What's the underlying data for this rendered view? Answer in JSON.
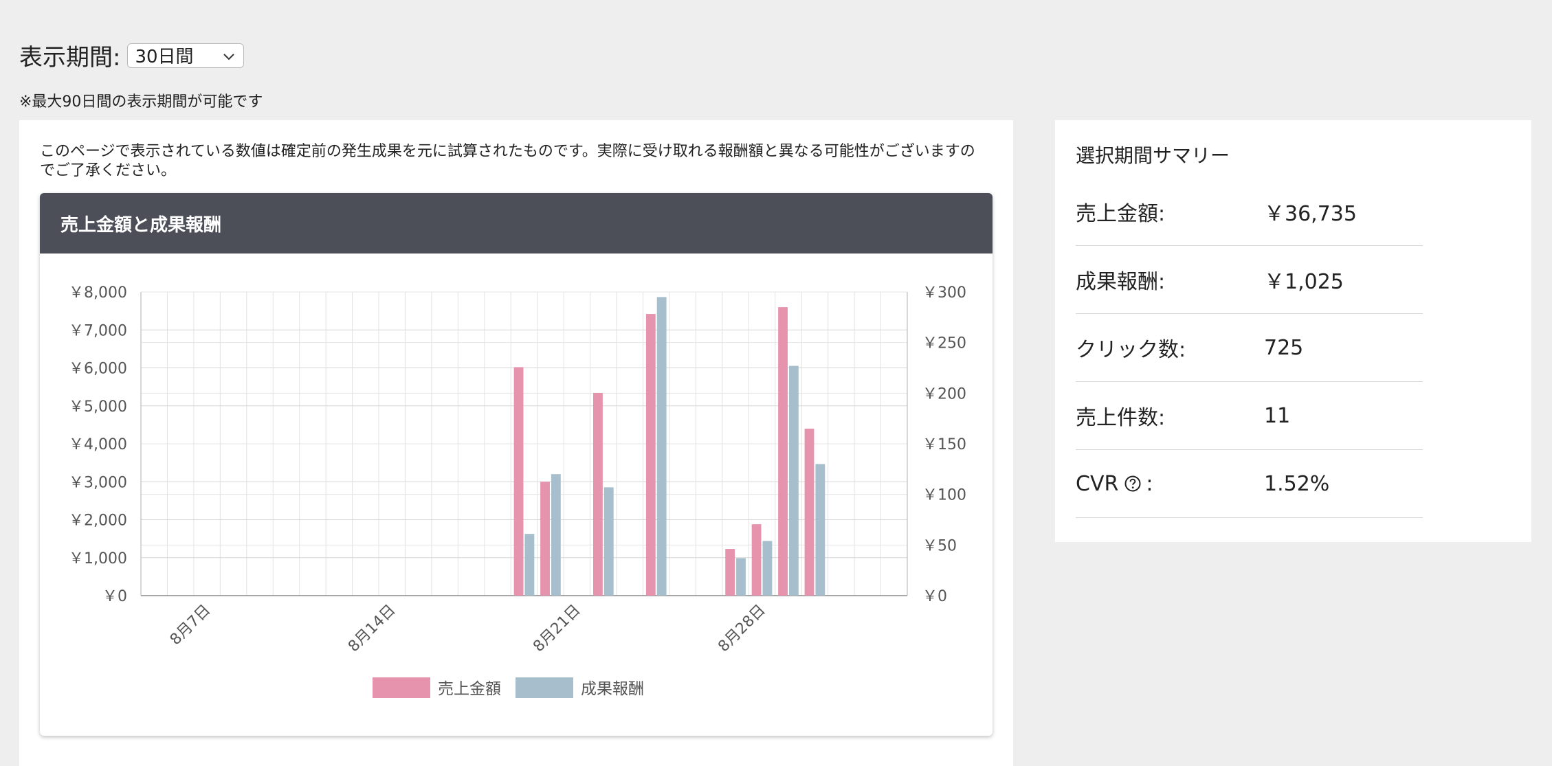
{
  "period": {
    "label": "表示期間:",
    "selected": "30日間",
    "note": "※最大90日間の表示期間が可能です"
  },
  "disclaimer": "このページで表示されている数値は確定前の発生成果を元に試算されたものです。実際に受け取れる報酬額と異なる可能性がございますのでご了承ください。",
  "chart_panel": {
    "title": "売上金額と成果報酬"
  },
  "chart_data": {
    "type": "bar",
    "title": "売上金額と成果報酬",
    "categories": [
      "8月5日",
      "8月6日",
      "8月7日",
      "8月8日",
      "8月9日",
      "8月10日",
      "8月11日",
      "8月12日",
      "8月13日",
      "8月14日",
      "8月15日",
      "8月16日",
      "8月17日",
      "8月18日",
      "8月19日",
      "8月20日",
      "8月21日",
      "8月22日",
      "8月23日",
      "8月24日",
      "8月25日",
      "8月26日",
      "8月27日",
      "8月28日",
      "8月29日",
      "8月30日",
      "8月31日",
      "9月1日",
      "9月2日"
    ],
    "tick_labels": [
      "8月7日",
      "8月14日",
      "8月21日",
      "8月28日"
    ],
    "series": [
      {
        "name": "売上金額",
        "axis": "left",
        "color": "#e693ae",
        "values": [
          0,
          0,
          0,
          0,
          0,
          0,
          0,
          0,
          0,
          0,
          0,
          0,
          0,
          0,
          6020,
          3000,
          0,
          5340,
          0,
          7420,
          0,
          0,
          1230,
          1880,
          7600,
          4400,
          0,
          0,
          0
        ]
      },
      {
        "name": "成果報酬",
        "axis": "right",
        "color": "#a7bfcc",
        "values": [
          0,
          0,
          0,
          0,
          0,
          0,
          0,
          0,
          0,
          0,
          0,
          0,
          0,
          0,
          61,
          120,
          0,
          107,
          0,
          295,
          0,
          0,
          37,
          54,
          227,
          130,
          0,
          0,
          0
        ]
      }
    ],
    "y_left": {
      "min": 0,
      "max": 8000,
      "ticks": [
        "￥0",
        "￥1,000",
        "￥2,000",
        "￥3,000",
        "￥4,000",
        "￥5,000",
        "￥6,000",
        "￥7,000",
        "￥8,000"
      ]
    },
    "y_right": {
      "min": 0,
      "max": 300,
      "ticks": [
        "￥0",
        "￥50",
        "￥100",
        "￥150",
        "￥200",
        "￥250",
        "￥300"
      ]
    },
    "grid": true,
    "legend_position": "bottom"
  },
  "summary": {
    "title": "選択期間サマリー",
    "rows": [
      {
        "label": "売上金額:",
        "value": "￥36,735"
      },
      {
        "label": "成果報酬:",
        "value": "￥1,025"
      },
      {
        "label": "クリック数:",
        "value": "725"
      },
      {
        "label": "売上件数:",
        "value": "11"
      },
      {
        "label": "CVR",
        "suffix": ":",
        "value": "1.52%",
        "icon": "question-circle-icon"
      }
    ]
  }
}
